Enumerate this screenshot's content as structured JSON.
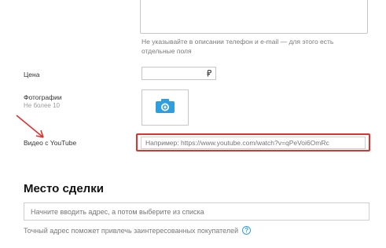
{
  "description": {
    "hint": "Не указывайте в описании телефон и e-mail — для этого есть отдельные поля"
  },
  "price": {
    "label": "Цена",
    "currency_icon": "ruble-icon"
  },
  "photos": {
    "label": "Фотографии",
    "sublabel": "Не более 10",
    "icon": "camera-icon"
  },
  "video": {
    "label": "Видео с YouTube",
    "placeholder": "Например: https://www.youtube.com/watch?v=qPeVoi6OmRc"
  },
  "deal_place": {
    "title": "Место сделки",
    "address_placeholder": "Начните вводить адрес, а потом выберите из списка",
    "hint": "Точный адрес поможет привлечь заинтересованных покупателей",
    "help_icon_glyph": "?"
  },
  "colors": {
    "highlight": "#e0322e",
    "accent": "#2f9ede"
  }
}
